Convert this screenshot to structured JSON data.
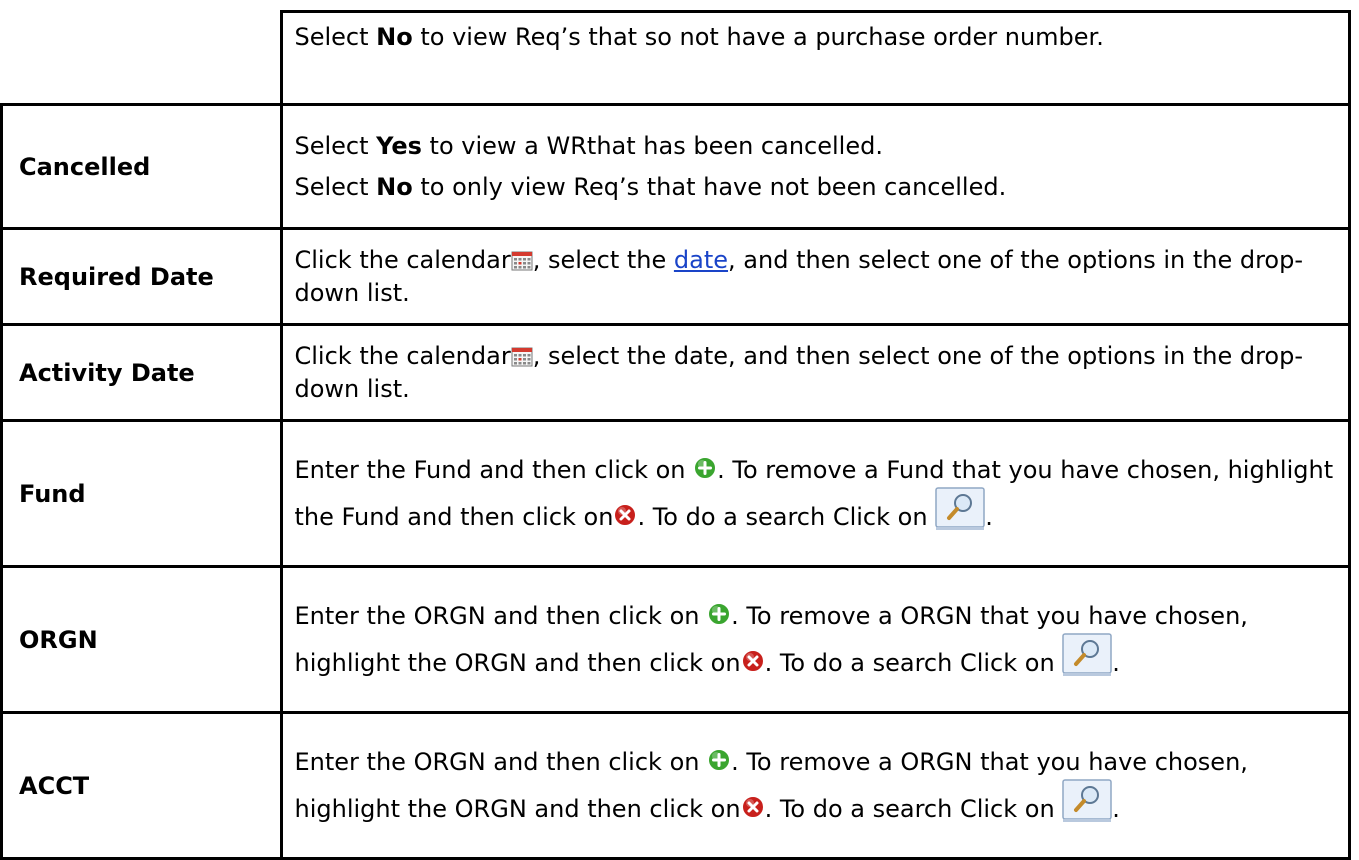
{
  "rows": [
    {
      "label": "",
      "desc": [
        [
          "text",
          "Select "
        ],
        [
          "bold",
          "No"
        ],
        [
          "text",
          " to view Req’s that so not have a purchase order number."
        ]
      ]
    },
    {
      "label": "Cancelled",
      "desc_lines": [
        [
          [
            "text",
            "Select "
          ],
          [
            "bold",
            "Yes"
          ],
          [
            "text",
            " to view a WRthat has been cancelled."
          ]
        ],
        [
          [
            "text",
            "Select "
          ],
          [
            "bold",
            "No"
          ],
          [
            "text",
            " to only view Req’s that have not been cancelled."
          ]
        ]
      ]
    },
    {
      "label": "Required Date",
      "desc": [
        [
          "text",
          "Click the calendar"
        ],
        [
          "icon",
          "calendar-icon"
        ],
        [
          "text",
          ", select the "
        ],
        [
          "link",
          "date"
        ],
        [
          "text",
          ", and then select one of the options in the drop-down list."
        ]
      ]
    },
    {
      "label": "Activity Date",
      "desc": [
        [
          "text",
          "Click the calendar"
        ],
        [
          "icon",
          "calendar-icon"
        ],
        [
          "text",
          ", select the date, and then select one of the options in the drop-down list."
        ]
      ]
    },
    {
      "label": "Fund",
      "desc": [
        [
          "text",
          "Enter the Fund and then click on "
        ],
        [
          "icon",
          "add-icon"
        ],
        [
          "text",
          ".  To remove a Fund that you have chosen, highlight the Fund and then click on"
        ],
        [
          "icon",
          "remove-icon"
        ],
        [
          "text",
          ".  To do a search Click on "
        ],
        [
          "icon",
          "search-icon"
        ],
        [
          "text",
          "."
        ]
      ]
    },
    {
      "label": "ORGN",
      "desc": [
        [
          "text",
          "Enter the ORGN and then click on "
        ],
        [
          "icon",
          "add-icon"
        ],
        [
          "text",
          ".  To remove a ORGN that you have chosen, highlight the ORGN and then click on"
        ],
        [
          "icon",
          "remove-icon"
        ],
        [
          "text",
          ".  To do a search Click on "
        ],
        [
          "icon",
          "search-icon"
        ],
        [
          "text",
          "."
        ]
      ]
    },
    {
      "label": "ACCT",
      "desc": [
        [
          "text",
          "Enter the ORGN and then click on "
        ],
        [
          "icon",
          "add-icon"
        ],
        [
          "text",
          ".  To remove a ORGN that you have chosen, highlight the ORGN and then click on"
        ],
        [
          "icon",
          "remove-icon"
        ],
        [
          "text",
          ".  To do a search Click on "
        ],
        [
          "icon",
          "search-icon"
        ],
        [
          "text",
          "."
        ]
      ]
    }
  ],
  "colors": {
    "border": "#000000",
    "link": "#1a44c8",
    "add": "#3aa52f",
    "remove": "#c8201c"
  }
}
